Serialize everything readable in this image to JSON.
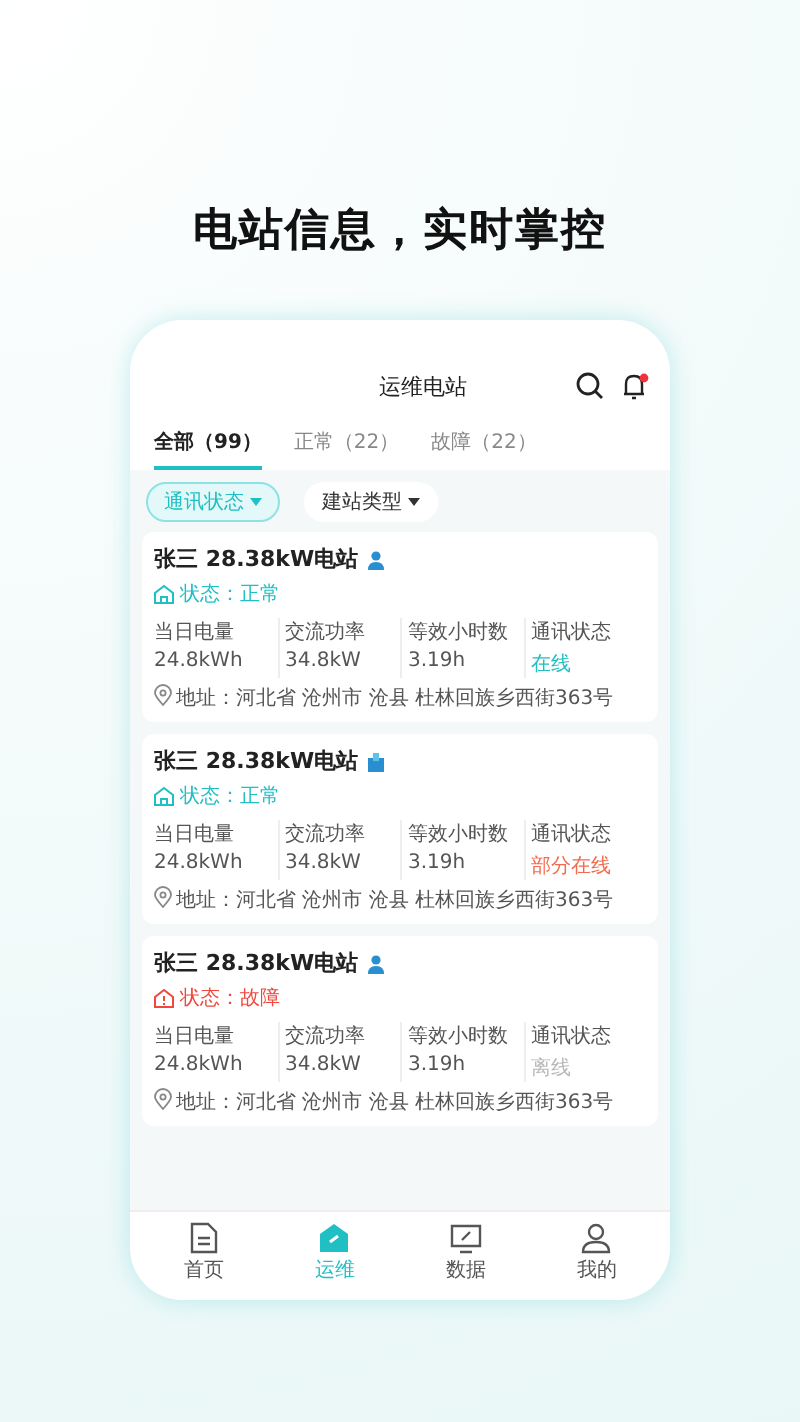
{
  "headline": "电站信息，实时掌控",
  "header": {
    "title": "运维电站",
    "notification_dot": true
  },
  "tabs": [
    {
      "label": "全部（99）",
      "selected": true
    },
    {
      "label": "正常（22）",
      "selected": false
    },
    {
      "label": "故障（22）",
      "selected": false
    }
  ],
  "filters": [
    {
      "label": "通讯状态",
      "selected": true
    },
    {
      "label": "建站类型",
      "selected": false
    }
  ],
  "stations": [
    {
      "name": "张三 28.38kW电站",
      "kind": "person",
      "status": {
        "text": "状态：正常",
        "kind": "normal"
      },
      "stats": [
        {
          "label": "当日电量",
          "value": "24.8kWh"
        },
        {
          "label": "交流功率",
          "value": "34.8kW"
        },
        {
          "label": "等效小时数",
          "value": "3.19h"
        }
      ],
      "comm": {
        "label": "通讯状态",
        "value": "在线",
        "kind": "online"
      },
      "address": "地址：河北省 沧州市 沧县 杜林回族乡西街363号"
    },
    {
      "name": "张三 28.38kW电站",
      "kind": "company",
      "status": {
        "text": "状态：正常",
        "kind": "normal"
      },
      "stats": [
        {
          "label": "当日电量",
          "value": "24.8kWh"
        },
        {
          "label": "交流功率",
          "value": "34.8kW"
        },
        {
          "label": "等效小时数",
          "value": "3.19h"
        }
      ],
      "comm": {
        "label": "通讯状态",
        "value": "部分在线",
        "kind": "partial"
      },
      "address": "地址：河北省 沧州市 沧县 杜林回族乡西街363号"
    },
    {
      "name": "张三 28.38kW电站",
      "kind": "person",
      "status": {
        "text": "状态：故障",
        "kind": "fault"
      },
      "stats": [
        {
          "label": "当日电量",
          "value": "24.8kWh"
        },
        {
          "label": "交流功率",
          "value": "34.8kW"
        },
        {
          "label": "等效小时数",
          "value": "3.19h"
        }
      ],
      "comm": {
        "label": "通讯状态",
        "value": "离线",
        "kind": "offline"
      },
      "address": "地址：河北省 沧州市 沧县 杜林回族乡西街363号"
    }
  ],
  "nav": [
    {
      "label": "首页",
      "selected": false
    },
    {
      "label": "运维",
      "selected": true
    },
    {
      "label": "数据",
      "selected": false
    },
    {
      "label": "我的",
      "selected": false
    }
  ]
}
